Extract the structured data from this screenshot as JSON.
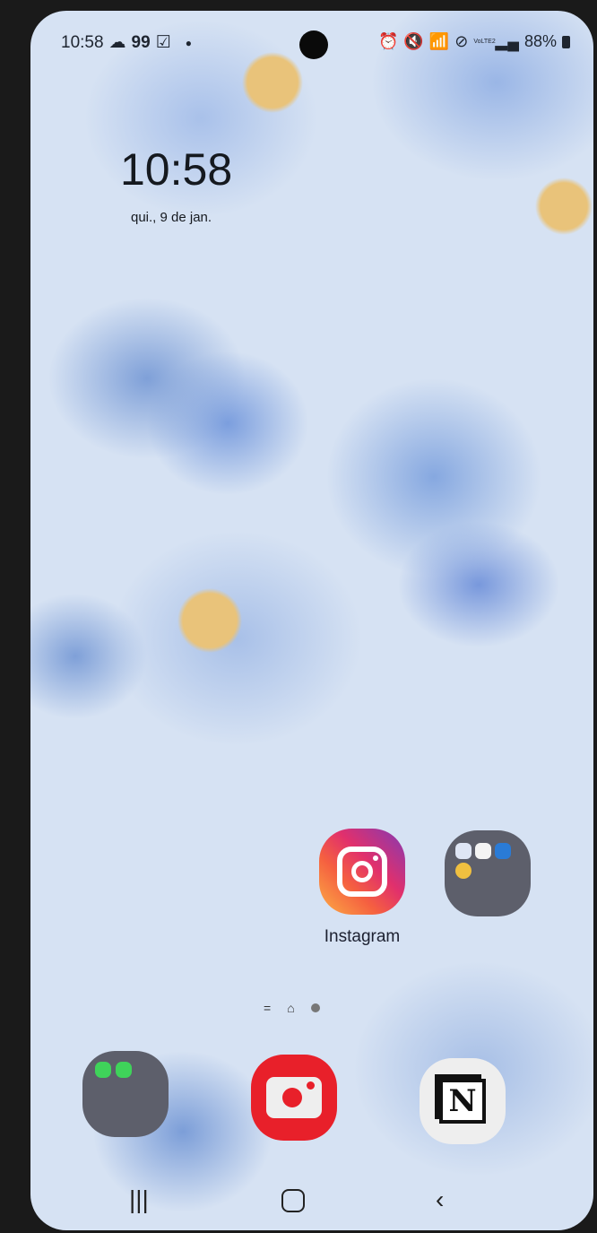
{
  "status_bar": {
    "time": "10:58",
    "notif_count": "99",
    "battery": "88%",
    "network": "VoLTE2"
  },
  "lock_clock": {
    "time": "10:58",
    "date": "qui., 9 de jan."
  },
  "apps": [
    {
      "label": "Instagram"
    }
  ],
  "dock": {
    "camera_label": "",
    "notion_glyph": "N"
  },
  "colors": {
    "instagram_start": "#fcaf45",
    "instagram_end": "#833ab4",
    "camera": "#e8202a",
    "folder": "#5d5f6b"
  }
}
